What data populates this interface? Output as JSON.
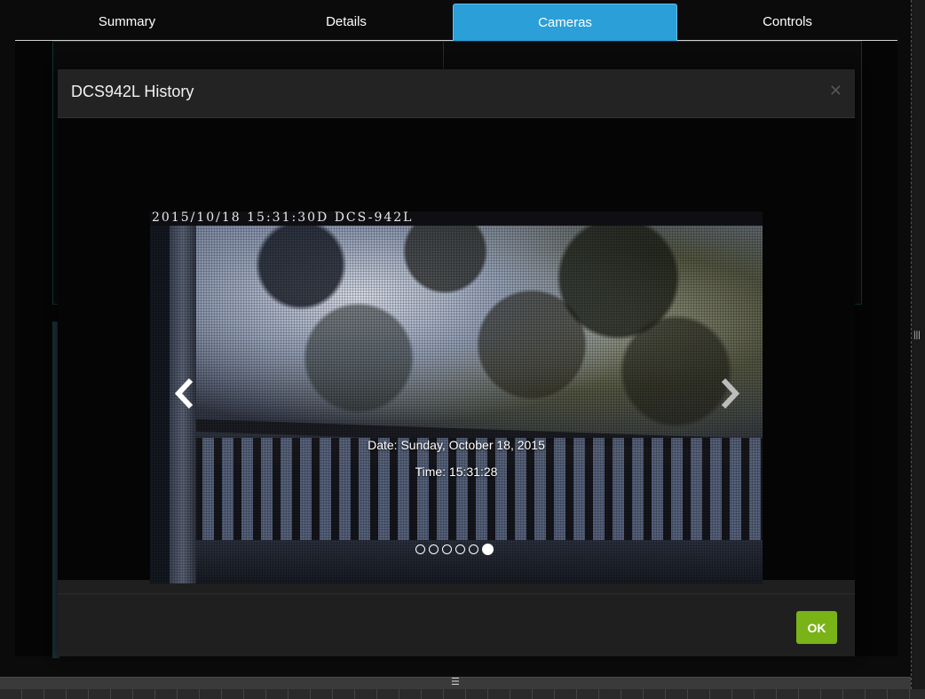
{
  "tabs": [
    {
      "label": "Summary",
      "active": false
    },
    {
      "label": "Details",
      "active": false
    },
    {
      "label": "Cameras",
      "active": true
    },
    {
      "label": "Controls",
      "active": false
    }
  ],
  "modal": {
    "title": "DCS942L History",
    "close_icon": "close-icon",
    "ok_label": "OK",
    "image": {
      "overlay_timestamp": "2015/10/18 15:31:30D DCS-942L"
    },
    "caption": {
      "date": "Date: Sunday, October 18, 2015",
      "time": "Time: 15:31:28"
    },
    "carousel": {
      "total_slides": 6,
      "active_index": 5,
      "prev_icon": "chevron-left-icon",
      "next_icon": "chevron-right-icon"
    }
  },
  "colors": {
    "active_tab": "#2b9fd8",
    "ok_button": "#7ab317",
    "modal_bg": "#1f1f1f"
  },
  "handles": {
    "right": "|||",
    "bottom": "☰"
  }
}
